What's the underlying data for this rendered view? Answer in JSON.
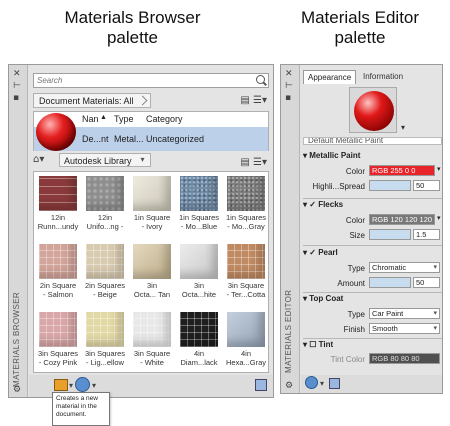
{
  "captions": {
    "browser": [
      "Materials Browser",
      "palette"
    ],
    "editor": [
      "Materials Editor",
      "palette"
    ]
  },
  "browser": {
    "side_title": "MATERIALS BROWSER",
    "search_placeholder": "Search",
    "doc_crumb": "Document Materials: All",
    "doc_columns": {
      "name": "Nan",
      "sort": "▲",
      "type": "Type",
      "category": "Category"
    },
    "doc_row": {
      "name": "De...nt",
      "type": "Metal...",
      "category": "Uncategorized"
    },
    "library_crumb": "Autodesk Library",
    "tiles": [
      {
        "label1": "12in",
        "label2": "Runn...undy",
        "color": "#8a3a3a",
        "texture": "brick"
      },
      {
        "label1": "12in",
        "label2": "Unifo...ng -",
        "color": "#8e8e8e",
        "texture": "stone"
      },
      {
        "label1": "1in Square",
        "label2": "- Ivory",
        "color": "#e6e0cf",
        "texture": "plain"
      },
      {
        "label1": "1in Squares",
        "label2": "- Mo...Blue",
        "color": "#6d8aa8",
        "texture": "speckle"
      },
      {
        "label1": "1in Squares",
        "label2": "- Mo...Gray",
        "color": "#7c7c7c",
        "texture": "speckle"
      },
      {
        "label1": "2in Square",
        "label2": "- Salmon",
        "color": "#d2a49a",
        "texture": "grid"
      },
      {
        "label1": "2in Squares",
        "label2": "- Beige",
        "color": "#d9cbb0",
        "texture": "grid"
      },
      {
        "label1": "3in",
        "label2": "Octa... Tan",
        "color": "#d6c49c",
        "texture": "plain"
      },
      {
        "label1": "3in",
        "label2": "Octa...hite",
        "color": "#e2e2e2",
        "texture": "plain"
      },
      {
        "label1": "3in Square",
        "label2": "- Ter...Cotta",
        "color": "#c08a62",
        "texture": "grid"
      },
      {
        "label1": "3in Squares",
        "label2": "- Cozy Pink",
        "color": "#d9a7a7",
        "texture": "grid"
      },
      {
        "label1": "3in Squares",
        "label2": "- Lig...ellow",
        "color": "#e3d9a6",
        "texture": "grid"
      },
      {
        "label1": "3in Square",
        "label2": "- White",
        "color": "#e8e8e8",
        "texture": "grid"
      },
      {
        "label1": "4in",
        "label2": "Diam...lack",
        "color": "#1f1f1f",
        "texture": "grid"
      },
      {
        "label1": "4in",
        "label2": "Hexa...Gray",
        "color": "#a6b7cc",
        "texture": "plain"
      }
    ],
    "tooltip": [
      "Creates a new",
      "material in the",
      "document."
    ]
  },
  "editor": {
    "side_title": "MATERIALS EDITOR",
    "tabs": [
      "Appearance",
      "Information"
    ],
    "material_title": "Default Metallic Paint",
    "sections": {
      "metallic_paint": {
        "title": "Metallic Paint",
        "color_label": "Color",
        "color_value": "RGB 255 0 0",
        "color_hex": "#e8242b",
        "spread_label": "Highli...Spread",
        "spread_value": "50"
      },
      "flecks": {
        "title": "Flecks",
        "color_label": "Color",
        "color_value": "RGB 120 120 120",
        "color_hex": "#787878",
        "size_label": "Size",
        "size_value": "1.5"
      },
      "pearl": {
        "title": "Pearl",
        "type_label": "Type",
        "type_value": "Chromatic",
        "amount_label": "Amount",
        "amount_value": "50"
      },
      "top_coat": {
        "title": "Top Coat",
        "type_label": "Type",
        "type_value": "Car Paint",
        "finish_label": "Finish",
        "finish_value": "Smooth"
      },
      "tint": {
        "title": "Tint",
        "color_label": "Tint Color",
        "color_value": "RGB 80 80 80",
        "color_hex": "#505050"
      }
    }
  }
}
